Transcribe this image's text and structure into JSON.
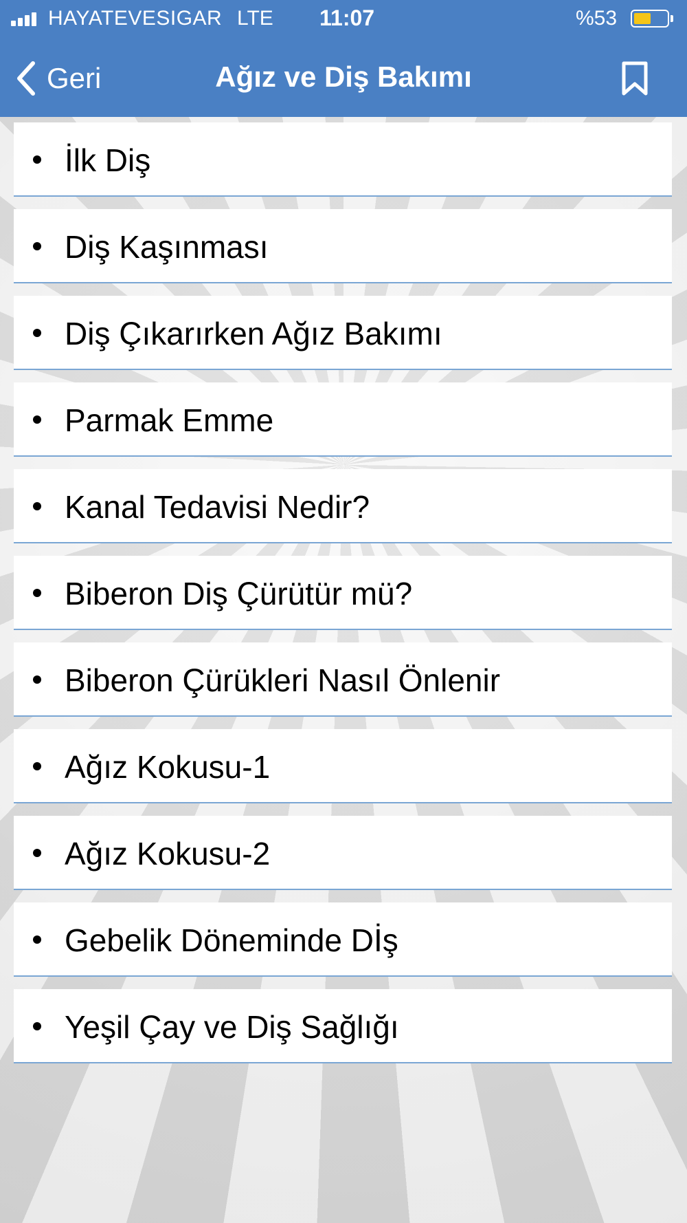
{
  "status_bar": {
    "carrier": "HAYATEVESIGAR",
    "network": "LTE",
    "time": "11:07",
    "battery_percent": "%53",
    "battery_level": 0.53,
    "battery_color": "#f5c518"
  },
  "header": {
    "back_label": "Geri",
    "title": "Ağız ve Diş Bakımı",
    "back_icon": "chevron-left-icon",
    "bookmark_icon": "bookmark-icon",
    "color": "#4a80c4"
  },
  "items": [
    {
      "label": "İlk Diş"
    },
    {
      "label": "Diş Kaşınması"
    },
    {
      "label": "Diş Çıkarırken Ağız Bakımı"
    },
    {
      "label": "Parmak Emme"
    },
    {
      "label": "Kanal Tedavisi Nedir?"
    },
    {
      "label": "Biberon Diş Çürütür mü?"
    },
    {
      "label": "Biberon Çürükleri Nasıl Önlenir"
    },
    {
      "label": "Ağız Kokusu-1"
    },
    {
      "label": "Ağız Kokusu-2"
    },
    {
      "label": "Gebelik Döneminde Dİş"
    },
    {
      "label": "Yeşil Çay ve Diş Sağlığı"
    }
  ]
}
